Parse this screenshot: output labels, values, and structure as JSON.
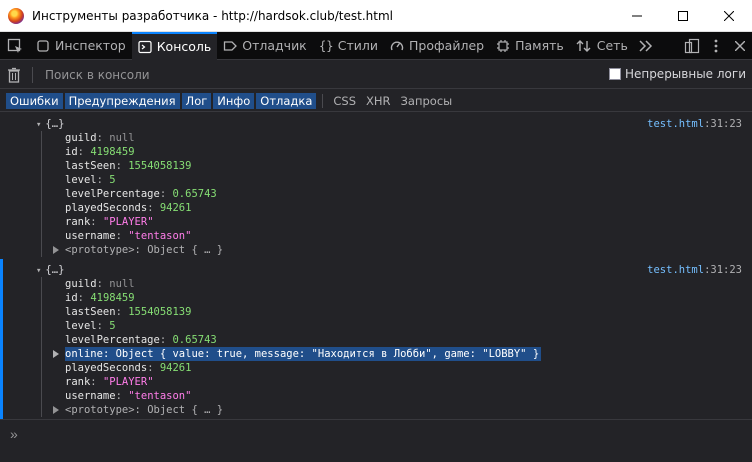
{
  "window": {
    "title": "Инструменты разработчика - http://hardsok.club/test.html"
  },
  "toolbar": {
    "tabs": [
      {
        "label": "Инспектор",
        "icon": "inspector-icon"
      },
      {
        "label": "Консоль",
        "icon": "console-icon"
      },
      {
        "label": "Отладчик",
        "icon": "debugger-icon"
      },
      {
        "label": "Стили",
        "icon": "braces-icon"
      },
      {
        "label": "Профайлер",
        "icon": "gauge-icon"
      },
      {
        "label": "Память",
        "icon": "memory-icon"
      },
      {
        "label": "Сеть",
        "icon": "network-icon"
      }
    ],
    "active_tab": "Консоль"
  },
  "filter": {
    "placeholder": "Поиск в консоли",
    "persist_label": "Непрерывные логи",
    "persist_checked": false
  },
  "categories": {
    "active": [
      "Ошибки",
      "Предупреждения",
      "Лог",
      "Инфо",
      "Отладка"
    ],
    "inactive": [
      "CSS",
      "XHR",
      "Запросы"
    ]
  },
  "colors": {
    "accent": "#0a84ff",
    "string": "#ff7de9",
    "number": "#86de74",
    "link": "#75bfff"
  },
  "console": {
    "entries": [
      {
        "header": "{…}",
        "location_file": "test.html",
        "location_pos": ":31:23",
        "rows": [
          {
            "key": "guild",
            "value": "null",
            "type": "null"
          },
          {
            "key": "id",
            "value": "4198459",
            "type": "number"
          },
          {
            "key": "lastSeen",
            "value": "1554058139",
            "type": "number"
          },
          {
            "key": "level",
            "value": "5",
            "type": "number"
          },
          {
            "key": "levelPercentage",
            "value": "0.65743",
            "type": "number"
          },
          {
            "key": "playedSeconds",
            "value": "94261",
            "type": "number"
          },
          {
            "key": "rank",
            "value": "\"PLAYER\"",
            "type": "string"
          },
          {
            "key": "username",
            "value": "\"tentason\"",
            "type": "string"
          },
          {
            "key": "<prototype>",
            "value": "Object { … }",
            "type": "object",
            "expandable": true
          }
        ]
      },
      {
        "header": "{…}",
        "location_file": "test.html",
        "location_pos": ":31:23",
        "rows": [
          {
            "key": "guild",
            "value": "null",
            "type": "null"
          },
          {
            "key": "id",
            "value": "4198459",
            "type": "number"
          },
          {
            "key": "lastSeen",
            "value": "1554058139",
            "type": "number"
          },
          {
            "key": "level",
            "value": "5",
            "type": "number"
          },
          {
            "key": "levelPercentage",
            "value": "0.65743",
            "type": "number"
          },
          {
            "key": "online",
            "value": "Object { value: true, message: \"Находится в Лобби\", game: \"LOBBY\" }",
            "type": "object",
            "expandable": true,
            "highlighted": true
          },
          {
            "key": "playedSeconds",
            "value": "94261",
            "type": "number"
          },
          {
            "key": "rank",
            "value": "\"PLAYER\"",
            "type": "string"
          },
          {
            "key": "username",
            "value": "\"tentason\"",
            "type": "string"
          },
          {
            "key": "<prototype>",
            "value": "Object { … }",
            "type": "object",
            "expandable": true
          }
        ]
      }
    ]
  },
  "input": {
    "prompt": "»"
  }
}
